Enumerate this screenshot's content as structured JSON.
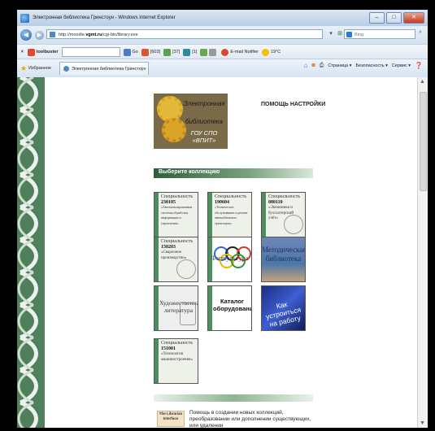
{
  "window": {
    "title": "Электронная библиотека Гринстоун - Windows Internet Explorer",
    "min": "–",
    "max": "□",
    "close": "✕"
  },
  "address": {
    "url_prefix": "http://moodle.",
    "url_domain": "vgmt.ru",
    "url_suffix": "/cgi-bin/library.exe",
    "search_placeholder": "Bing"
  },
  "toolbar": {
    "brand": "toolbuster",
    "go": "Go",
    "counts": [
      "[603]",
      "[37]",
      "[1]"
    ],
    "email_notifier": "E-mail Notifier",
    "weather": "19°C"
  },
  "favorites": {
    "label": "Избранное",
    "tab_title": "Электронная библиотека Гринстоун",
    "cmd": [
      "Страница ▾",
      "Безопасность ▾",
      "Сервис ▾"
    ]
  },
  "page": {
    "logo_lines": [
      "Электронная",
      "библиотека",
      "ГОУ СПО «ВПИТ»"
    ],
    "help": "ПОМОЩЬ",
    "settings": "НАСТРОЙКИ",
    "select_collection": "Выберите коллекцию",
    "tiles": [
      {
        "t1": "Специальность",
        "t2": "230105",
        "t3": "«Автоматизированные системы обработки информации и управления»"
      },
      {
        "t1": "Специальность",
        "t2": "190604",
        "t3": "«Техническое обслуживание и ремонт автомобильного транспорта»"
      },
      {
        "t1": "Специальность",
        "t2": "080110",
        "t3": "«Экономика и бухгалтерский учёт»"
      },
      {
        "t1": "Специальность",
        "t2": "150203",
        "t3": "«Сварочное производство»"
      },
      {
        "big": "Физкультура"
      },
      {
        "big": "Методическая библиотека"
      },
      {
        "big": "Художественная литература"
      },
      {
        "big": "Каталог оборудования"
      },
      {
        "big": "Как устроиться на работу"
      },
      {
        "t1": "Специальность",
        "t2": "151001",
        "t3": "«Технология машиностроения»"
      }
    ],
    "librarian_interface": "The Librarian Interface",
    "librarian_text": "Помощь в создании новых коллекций, преобразовании или дополнении существующих, или удалении"
  }
}
